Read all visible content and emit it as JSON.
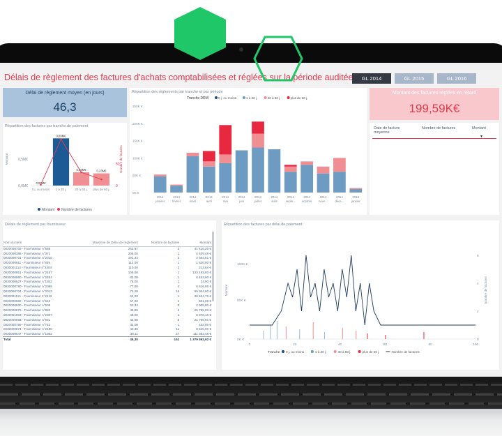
{
  "title": "Délais de règlement des factures d'achats comptabilisées et réglées sur la période auditée",
  "tabs": [
    "GL 2014",
    "GL 2015",
    "GL 2016"
  ],
  "kpi_delay": {
    "title": "Délai de règlement moyen (en jours)",
    "value": "46,3"
  },
  "kpi_late": {
    "title": "Montant des factures réglées en retard",
    "value": "199,59K€"
  },
  "slicer": {
    "col_date": "Date de facture moyenne",
    "col_count": "Nombre de factures",
    "col_amount": "Montant"
  },
  "colors": {
    "accent_red": "#e03a4e",
    "blue": "#6e9bc1",
    "dark_blue": "#1c4d80",
    "pink": "#f08f93",
    "tab_active": "#333a43",
    "tab_inactive": "#a7b6c8",
    "hexagon": "#20c768"
  },
  "tranche_chart": {
    "title": "Répartition des factures par tranche de paiement",
    "ylabel_left": "Montant",
    "ylabel_right": "Nombre de factures",
    "left_ticks": [
      "0,5M€",
      "0,0M€"
    ],
    "right_ticks": [
      "50",
      "0"
    ],
    "legend": [
      "Montant",
      "Nombre de factures"
    ]
  },
  "monthly_chart": {
    "title": "Répartition des règlements par tranche et par période",
    "legend_title": "Tranche DRM",
    "y_ticks": [
      "250K €",
      "200K €",
      "150K €",
      "100K €",
      "50K €",
      "0K €"
    ]
  },
  "delay_chart": {
    "title": "Répartition des factures par délai de paiement",
    "ylabel_left": "Montant",
    "ylabel_right": "Nombre de factures",
    "y_ticks": [
      "100K €",
      "50K €",
      "0K €"
    ],
    "y2_ticks": [
      "6",
      "4",
      "2",
      "0"
    ],
    "x_ticks": [
      "0",
      "20",
      "40",
      "60",
      "80",
      "100"
    ],
    "legend_title": "Tranche",
    "legend_items": [
      "0 j. ou moins",
      "1 à 30 j.",
      "30 à 60 j.",
      "plus de 60 j.",
      "Nombre de factures"
    ]
  },
  "supplier_table": {
    "title": "Délais de règlement par fournisseur",
    "headers": [
      "Nom du tiers",
      "Moyenne de Délai de règlement",
      "Nombre de factures",
      "Montant"
    ],
    "rows": [
      [
        "0020000709 - Fournisseur n°565",
        "242,67",
        "3",
        "41 416,20 €"
      ],
      [
        "0020000388 - Fournisseur n°371",
        "206,00",
        "1",
        "4 409,49 €"
      ],
      [
        "0030000701 - Fournisseur n°2010",
        "191,33",
        "3",
        "2 564,61 €"
      ],
      [
        "0020000911 - Fournisseur n°849",
        "112,00",
        "1",
        "1 620,00 €"
      ],
      [
        "0030001113 - Fournisseur n°2404",
        "110,00",
        "2",
        "213,84 €"
      ],
      [
        "0030000851 - Fournisseur n°2157",
        "109,00",
        "1",
        "123 193,80 €"
      ],
      [
        "0030000960 - Fournisseur n°2264",
        "82,00",
        "1",
        "6 453,90 €"
      ],
      [
        "0030000527 - Fournisseur n°1842",
        "78,00",
        "1",
        "34,90 €"
      ],
      [
        "0030000780 - Fournisseur n°2086",
        "77,50",
        "4",
        "6 616,06 €"
      ],
      [
        "0030000704 - Fournisseur n°2013",
        "72,20",
        "15",
        "65 304,90 €"
      ],
      [
        "0030001121 - Fournisseur n°2412",
        "62,00",
        "1",
        "30 524,76 €"
      ],
      [
        "0020000682 - Fournisseur n°642",
        "57,00",
        "1",
        "501,09 €"
      ],
      [
        "0020000530 - Fournisseur n°505",
        "53,33",
        "3",
        "2 008,80 €"
      ],
      [
        "0020000879 - Fournisseur n°820",
        "48,50",
        "2",
        "25 765,20 €"
      ],
      [
        "0030001003 - Fournisseur n°2307",
        "48,00",
        "1",
        "5 870,16 €"
      ],
      [
        "0020000593 - Fournisseur n°561",
        "42,80",
        "5",
        "21 765,01 €"
      ],
      [
        "0020000789 - Fournisseur n°742",
        "41,00",
        "1",
        "432,00 €"
      ],
      [
        "0030000874 - Fournisseur n°2180",
        "40,36",
        "11",
        "6 645,00 €"
      ],
      [
        "0030000547 - Fournisseur n°1862",
        "38,11",
        "27",
        "111 363,48 €"
      ]
    ],
    "total": [
      "Total",
      "46,30",
      "151",
      "1 379 392,92 €"
    ]
  },
  "chart_data": [
    {
      "type": "bar",
      "title": "Répartition des factures par tranche de paiement",
      "categories": [
        "0 j. ou moins",
        "1 à 30 j.",
        "30 à 60 j.",
        "plus de 60 j."
      ],
      "series": [
        {
          "name": "Montant",
          "values": [
            0.0,
            0.89,
            0.25,
            0.23
          ],
          "data_labels": [
            "0,00M€",
            "0,89M€",
            "0,25M€",
            "0,23M€"
          ]
        },
        {
          "name": "Nombre de factures",
          "values": [
            2,
            105,
            30,
            14
          ]
        }
      ],
      "ylim_left": [
        0,
        1.0
      ],
      "ylim_right": [
        0,
        120
      ]
    },
    {
      "type": "bar",
      "title": "Répartition des règlements par tranche et par période",
      "categories": [
        "2014 janvier",
        "2014 février",
        "2014 mars",
        "2014 avril",
        "2014 mai",
        "2014 juin",
        "2014 juillet",
        "2014 août",
        "2014 septe...",
        "2014 octobre",
        "2014 nove...",
        "2014 déce...",
        "2015 janvier"
      ],
      "series": [
        {
          "name": "0 j. ou moins",
          "values": [
            0,
            0,
            0,
            0,
            0,
            0,
            0,
            0,
            0,
            0,
            0,
            0,
            0
          ]
        },
        {
          "name": "1 à 30 j.",
          "values": [
            47,
            20,
            105,
            75,
            85,
            122,
            130,
            125,
            60,
            80,
            55,
            60,
            10
          ]
        },
        {
          "name": "30 à 60 j.",
          "values": [
            5,
            3,
            10,
            15,
            25,
            0,
            40,
            0,
            15,
            10,
            20,
            40,
            3
          ]
        },
        {
          "name": "plus de 60 j.",
          "values": [
            0,
            0,
            0,
            30,
            85,
            0,
            35,
            0,
            5,
            0,
            0,
            0,
            0
          ]
        }
      ],
      "ylim": [
        0,
        250
      ]
    },
    {
      "type": "line",
      "title": "Répartition des factures par délai de paiement",
      "x": [
        0,
        5,
        10,
        14,
        17,
        19,
        21,
        23,
        25,
        27,
        29,
        31,
        33,
        35,
        37,
        39,
        41,
        43,
        45,
        47,
        49,
        51,
        53,
        55,
        58,
        62,
        66,
        70,
        80,
        90,
        100
      ],
      "series": [
        {
          "name": "Nombre de factures",
          "values": [
            1,
            1,
            1,
            2,
            4,
            3,
            5,
            2,
            6,
            3,
            4,
            2,
            5,
            3,
            4,
            2,
            5,
            3,
            6,
            2,
            4,
            1,
            4,
            2,
            1,
            1,
            1,
            1,
            1,
            1,
            1
          ]
        }
      ],
      "ylim": [
        0,
        7
      ]
    }
  ]
}
